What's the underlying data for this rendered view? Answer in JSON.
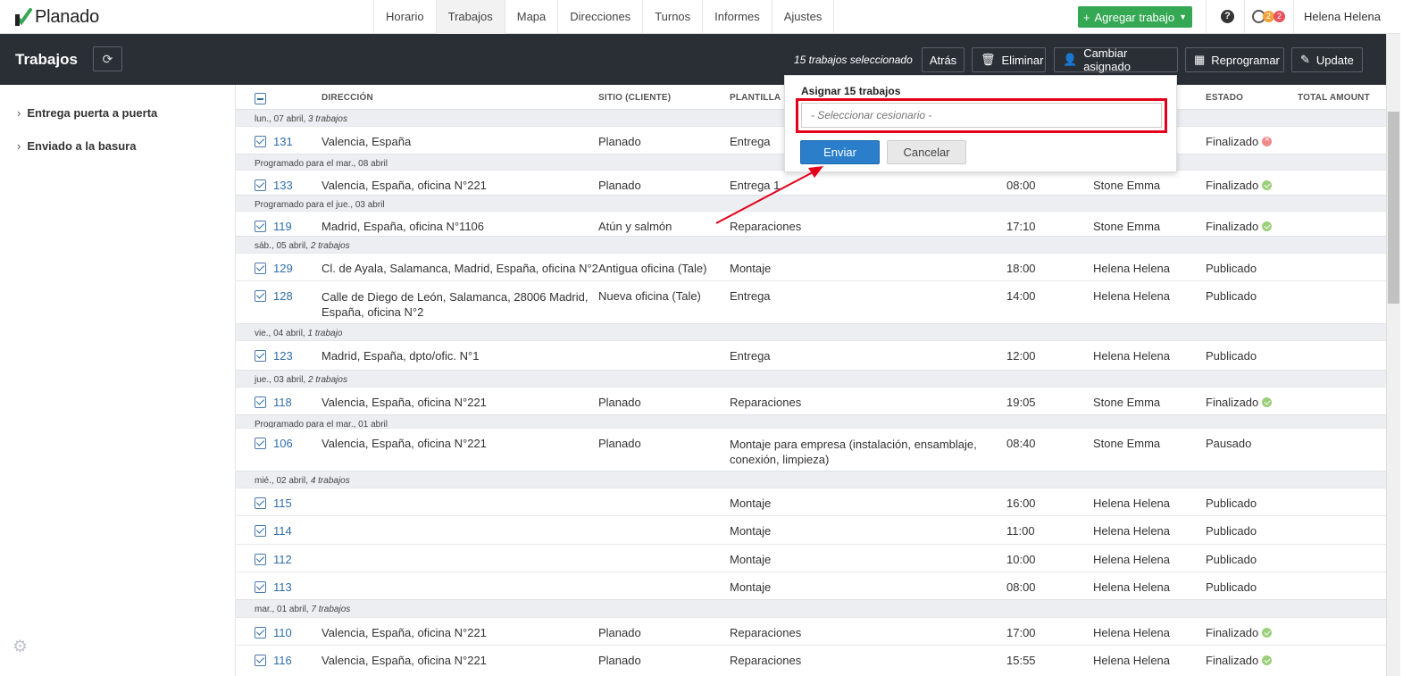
{
  "app": {
    "logo": "Planado",
    "user": "Helena Helena",
    "notif_a": "2",
    "notif_b": "2"
  },
  "nav": {
    "tabs": [
      "Horario",
      "Trabajos",
      "Mapa",
      "Direcciones",
      "Turnos",
      "Informes",
      "Ajustes"
    ],
    "add_job": "Agregar trabajo"
  },
  "toolbar": {
    "title": "Trabajos",
    "selected": "15 trabajos seleccionado",
    "back": "Atrás",
    "delete": "Eliminar",
    "change_assignee": "Cambiar asignado",
    "reschedule": "Reprogramar",
    "update": "Update"
  },
  "sidebar": {
    "items": [
      "Entrega puerta a puerta",
      "Enviado a la basura"
    ]
  },
  "columns": {
    "address": "DIRECCIÓN",
    "site": "SITIO (CLIENTE)",
    "template": "PLANTILLA",
    "status": "ESTADO",
    "total": "TOTAL AMOUNT"
  },
  "groups": [
    {
      "date": "lun., 07 abril,",
      "count": "3 trabajos"
    },
    {
      "date": "Programado para el mar., 08 abril",
      "count": ""
    },
    {
      "date": "Programado para el jue., 03 abril",
      "count": ""
    },
    {
      "date": "sáb., 05 abril,",
      "count": "2 trabajos"
    },
    {
      "date": "vie., 04 abril,",
      "count": "1 trabajo"
    },
    {
      "date": "jue., 03 abril,",
      "count": "2 trabajos"
    },
    {
      "date": "Programado para el mar., 01 abril",
      "count": ""
    },
    {
      "date": "mié., 02 abril,",
      "count": "4 trabajos"
    },
    {
      "date": "mar., 01 abril,",
      "count": "7 trabajos"
    }
  ],
  "rows": [
    {
      "id": "131",
      "address": "Valencia, España",
      "site": "Planado",
      "template": "Entrega",
      "time": "",
      "assignee": "",
      "status": "Finalizado",
      "status_color": "red"
    },
    {
      "id": "133",
      "address": "Valencia, España, oficina N°221",
      "site": "Planado",
      "template": "Entrega 1",
      "time": "08:00",
      "assignee": "Stone Emma",
      "status": "Finalizado",
      "status_color": "green"
    },
    {
      "id": "119",
      "address": "Madrid, España, oficina N°1106",
      "site": "Atún y salmón",
      "template": "Reparaciones",
      "time": "17:10",
      "assignee": "Stone Emma",
      "status": "Finalizado",
      "status_color": "green"
    },
    {
      "id": "129",
      "address": "Cl. de Ayala, Salamanca, Madrid, España, oficina N°2",
      "site": "Antigua oficina (Tale)",
      "template": "Montaje",
      "time": "18:00",
      "assignee": "Helena Helena",
      "status": "Publicado",
      "status_color": ""
    },
    {
      "id": "128",
      "address": "Calle de Diego de León, Salamanca, 28006 Madrid,",
      "address2": "España, oficina N°2",
      "site": "Nueva oficina (Tale)",
      "template": "Entrega",
      "time": "14:00",
      "assignee": "Helena Helena",
      "status": "Publicado",
      "status_color": ""
    },
    {
      "id": "123",
      "address": "Madrid, España, dpto/ofic. N°1",
      "site": "",
      "template": "Entrega",
      "time": "12:00",
      "assignee": "Helena Helena",
      "status": "Publicado",
      "status_color": ""
    },
    {
      "id": "118",
      "address": "Valencia, España, oficina N°221",
      "site": "Planado",
      "template": "Reparaciones",
      "time": "19:05",
      "assignee": "Stone Emma",
      "status": "Finalizado",
      "status_color": "green"
    },
    {
      "id": "106",
      "address": "Valencia, España, oficina N°221",
      "site": "Planado",
      "template": "Montaje para empresa (instalación, ensamblaje,",
      "template2": "conexión, limpieza)",
      "time": "08:40",
      "assignee": "Stone Emma",
      "status": "Pausado",
      "status_color": ""
    },
    {
      "id": "115",
      "address": "",
      "site": "",
      "template": "Montaje",
      "time": "16:00",
      "assignee": "Helena Helena",
      "status": "Publicado",
      "status_color": ""
    },
    {
      "id": "114",
      "address": "",
      "site": "",
      "template": "Montaje",
      "time": "11:00",
      "assignee": "Helena Helena",
      "status": "Publicado",
      "status_color": ""
    },
    {
      "id": "112",
      "address": "",
      "site": "",
      "template": "Montaje",
      "time": "10:00",
      "assignee": "Helena Helena",
      "status": "Publicado",
      "status_color": ""
    },
    {
      "id": "113",
      "address": "",
      "site": "",
      "template": "Montaje",
      "time": "08:00",
      "assignee": "Helena Helena",
      "status": "Publicado",
      "status_color": ""
    },
    {
      "id": "110",
      "address": "Valencia, España, oficina N°221",
      "site": "Planado",
      "template": "Reparaciones",
      "time": "17:00",
      "assignee": "Helena Helena",
      "status": "Finalizado",
      "status_color": "green"
    },
    {
      "id": "116",
      "address": "Valencia, España, oficina N°221",
      "site": "Planado",
      "template": "Reparaciones",
      "time": "15:55",
      "assignee": "Helena Helena",
      "status": "Finalizado",
      "status_color": "green"
    }
  ],
  "popup": {
    "title": "Asignar 15 trabajos",
    "placeholder": "- Seleccionar cesionario -",
    "send": "Enviar",
    "cancel": "Cancelar"
  },
  "colors": {
    "accent": "#2b7fca",
    "add_button": "#34a853",
    "toolbar_bg": "#2a2f36",
    "highlight": "#e3001b"
  }
}
